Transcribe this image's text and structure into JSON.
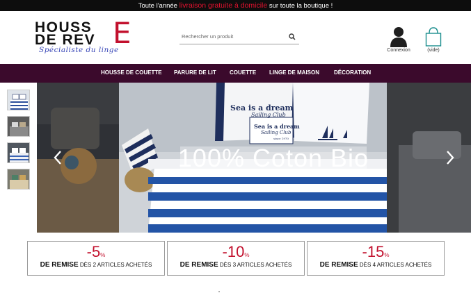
{
  "topbar": {
    "pre": "Toute l'année",
    "highlight": "livraison gratuite à domicile",
    "post": "sur toute la boutique !"
  },
  "logo": {
    "line1": "HOUSS",
    "line2": "DE REV",
    "big_letter": "E",
    "tagline": "Spécialiste du linge"
  },
  "search": {
    "placeholder": "Rechercher un produit",
    "icon": "search-icon"
  },
  "account": {
    "label": "Connexion",
    "icon": "user-icon"
  },
  "cart": {
    "label": "(vide)",
    "icon": "bag-icon"
  },
  "nav": {
    "items": [
      "HOUSSE DE COUETTE",
      "PARURE DE LIT",
      "COUETTE",
      "LINGE DE MAISON",
      "DÉCORATION"
    ]
  },
  "slider": {
    "caption": "100% Coton Bio",
    "pillow_text_1": "Sea is a dream",
    "pillow_text_2": "Sailing Club",
    "pillow_text_3": "since 1970",
    "prev_icon": "chevron-left-icon",
    "next_icon": "chevron-right-icon"
  },
  "promos": [
    {
      "value": "-5",
      "unit": "%",
      "strong": "DE REMISE",
      "rest": "DÈS 2 ARTICLES ACHETÉS"
    },
    {
      "value": "-10",
      "unit": "%",
      "strong": "DE REMISE",
      "rest": "DÈS 3 ARTICLES ACHETÉS"
    },
    {
      "value": "-15",
      "unit": "%",
      "strong": "DE REMISE",
      "rest": "DÈS 4 ARTICLES ACHETÉS"
    }
  ],
  "colors": {
    "accent": "#c2102d",
    "nav_bg": "#3b0a2c",
    "topbar_bg": "#0d0d0d",
    "tagline": "#3b49b8"
  }
}
